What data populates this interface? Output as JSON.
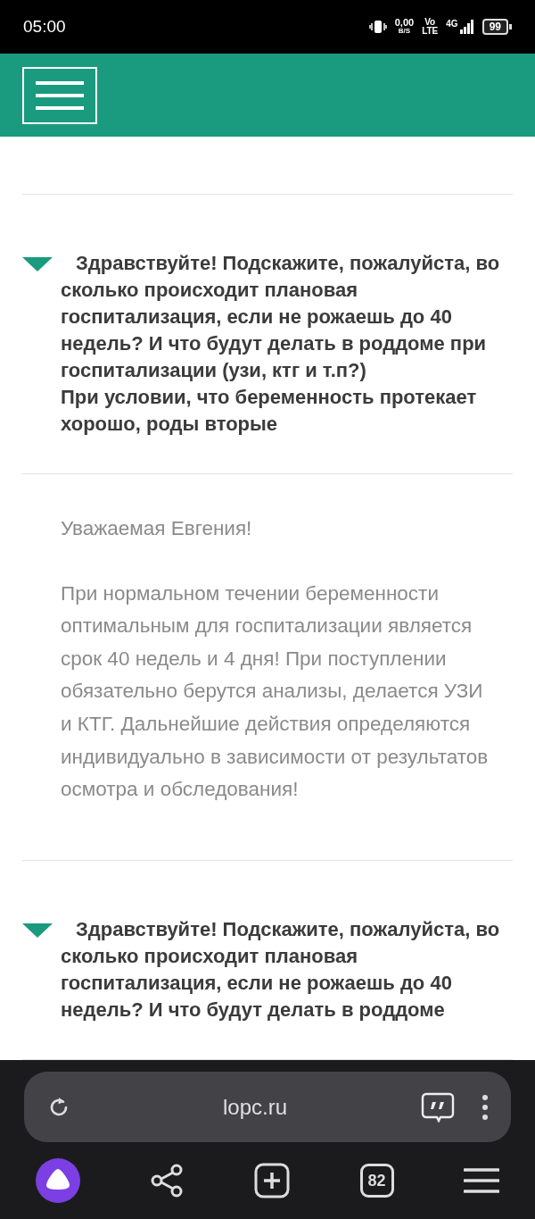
{
  "status_bar": {
    "time": "05:00",
    "speed_value": "0,00",
    "speed_unit": "B/S",
    "volte_top": "Vo",
    "volte_bottom": "LTE",
    "network": "4G",
    "battery": "99"
  },
  "entries": [
    {
      "kind": "question",
      "expanded": true,
      "paragraphs": [
        "Здравствуйте! Подскажите, пожалуйста, во сколько происходит плановая госпитализация, если не рожаешь до 40 недель? И что будут делать в роддоме при госпитализации (узи, ктг и т.п?)",
        "При условии, что беременность протекает хорошо, роды вторые"
      ]
    },
    {
      "kind": "answer",
      "paragraphs": [
        "Уважаемая Евгения!",
        "При нормальном течении беременности оптимальным для госпитализации является срок 40 недель и 4 дня! При поступлении обязательно берутся анализы, делается УЗИ и КТГ. Дальнейшие действия определяются индивидуально в зависимости от результатов осмотра и обследования!"
      ]
    },
    {
      "kind": "question",
      "expanded": true,
      "paragraphs": [
        "Здравствуйте! Подскажите, пожалуйста, во сколько происходит плановая госпитализация, если не рожаешь до 40 недель? И что будут делать в роддоме"
      ]
    }
  ],
  "browser_bar": {
    "url": "lopc.ru",
    "tabs_count": "82"
  }
}
